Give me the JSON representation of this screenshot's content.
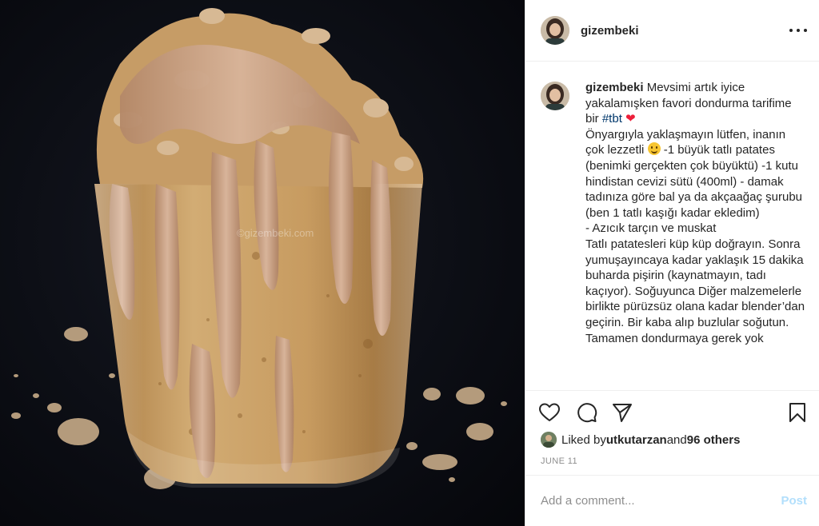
{
  "post": {
    "username": "gizembeki",
    "watermark": "©gizembeki.com",
    "caption": {
      "username": "gizembeki",
      "intro": " Mevsimi artık iyice yakalamışken favori dondurma tarifime bir ",
      "hashtag": "#tbt",
      "heart": "❤",
      "line2": "Önyargıyla yaklaşmayın lütfen, inanın çok lezzetli ",
      "line2b": " -1 büyük tatlı patates (benimki gerçekten çok büyüktü) -1 kutu hindistan cevizi sütü (400ml) - damak tadınıza göre bal ya da akçaağaç şurubu (ben 1 tatlı kaşığı kadar ekledim)",
      "line3": "- Azıcık tarçın ve muskat",
      "line4": "Tatlı patatesleri küp küp doğrayın. Sonra yumuşayıncaya kadar yaklaşık 15 dakika buharda pişirin (kaynatmayın, tadı kaçıyor). Soğuyunca Diğer malzemelerle birlikte pürüzsüz olana kadar blender’dan geçirin. Bir kaba alıp buzlular soğutun.",
      "line5": "Tamamen dondurmaya gerek yok"
    },
    "likes": {
      "prefix": "Liked by ",
      "user": "utkutarzan",
      "middle": " and ",
      "others": "96 others"
    },
    "date": "JUNE 11",
    "comment": {
      "placeholder": "Add a comment...",
      "post_label": "Post"
    }
  },
  "icons": {
    "like": "heart-outline-icon",
    "comment": "speech-bubble-icon",
    "share": "paper-plane-icon",
    "save": "bookmark-icon",
    "more": "ellipsis-icon"
  },
  "colors": {
    "hashtag": "#00376b",
    "post_disabled": "#b2dffc",
    "muted": "#8e8e8e",
    "photo_background": "#0a0c12",
    "sauce": "#c9a183",
    "ice_cream": "#c8a06a"
  }
}
